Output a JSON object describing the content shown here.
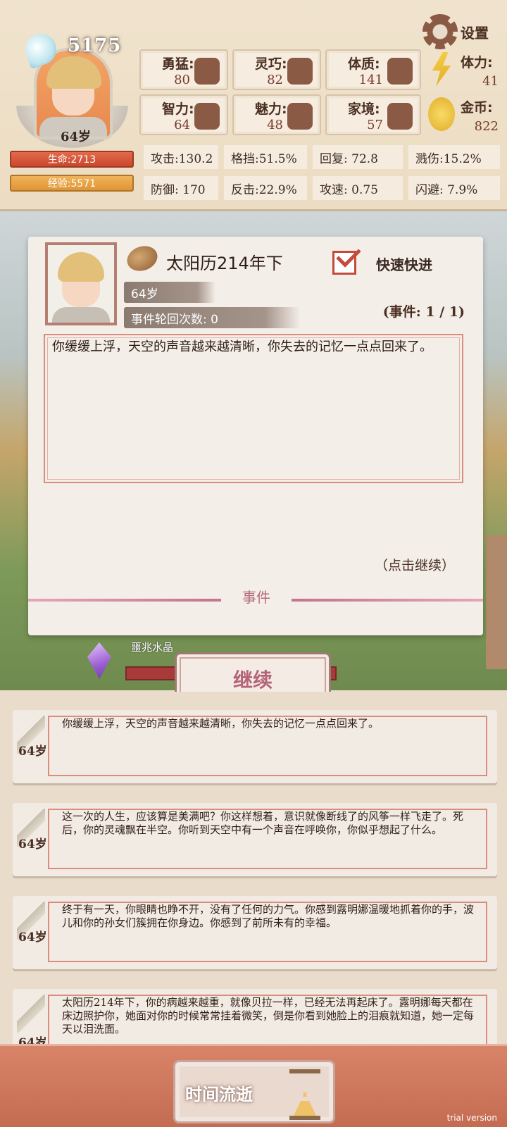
{
  "header": {
    "settings_label": "设置",
    "power_value": "5175",
    "age_badge": "64岁",
    "hp_bar_label": "生命:2713",
    "exp_bar_label": "经验:5571"
  },
  "attributes": [
    {
      "label": "勇猛:",
      "value": "80",
      "icon": "fist-icon"
    },
    {
      "label": "灵巧:",
      "value": "82",
      "icon": "cloak-icon"
    },
    {
      "label": "体质:",
      "value": "141",
      "icon": "muscle-arm-icon"
    },
    {
      "label": "体力:",
      "value": "41",
      "icon": "lightning-icon"
    },
    {
      "label": "智力:",
      "value": "64",
      "icon": "brain-icon"
    },
    {
      "label": "魅力:",
      "value": "48",
      "icon": "flower-icon"
    },
    {
      "label": "家境:",
      "value": "57",
      "icon": "coin-hand-icon"
    },
    {
      "label": "金币:",
      "value": "822",
      "icon": "gold-coin-icon"
    }
  ],
  "combat_stats": [
    {
      "label": "攻击:130.2"
    },
    {
      "label": "格挡:51.5%"
    },
    {
      "label": "回复:  72.8"
    },
    {
      "label": "溅伤:15.2%"
    },
    {
      "label": "防御:  170"
    },
    {
      "label": "反击:22.9%"
    },
    {
      "label": "攻速:  0.75"
    },
    {
      "label": "闪避:  7.9%"
    }
  ],
  "event": {
    "era": "太阳历214年下",
    "age": "64岁",
    "cycle_label": "事件轮回次数: 0",
    "fast_forward_label": "快速快进",
    "event_counter": "(事件: 1 / 1)",
    "text": "你缓缓上浮，天空的声音越来越清晰，你失去的记忆一点点回来了。",
    "click_continue": "（点击继续）",
    "footer_label": "事件"
  },
  "crystal": {
    "label": "噩兆水晶"
  },
  "continue_button": "继续",
  "log": [
    {
      "age": "64岁",
      "text": "你缓缓上浮，天空的声音越来越清晰，你失去的记忆一点点回来了。"
    },
    {
      "age": "64岁",
      "text": "这一次的人生，应该算是美满吧？你这样想着，意识就像断线了的风筝一样飞走了。死后，你的灵魂飘在半空。你听到天空中有一个声音在呼唤你，你似乎想起了什么。"
    },
    {
      "age": "64岁",
      "text": "终于有一天，你眼睛也睁不开，没有了任何的力气。你感到露明娜温暖地抓着你的手，波儿和你的孙女们簇拥在你身边。你感到了前所未有的幸福。"
    },
    {
      "age": "64岁",
      "text": "太阳历214年下，你的病越来越重，就像贝拉一样，已经无法再起床了。露明娜每天都在床边照护你，她面对你的时候常常挂着微笑，倒是你看到她脸上的泪痕就知道，她一定每天以泪洗面。"
    }
  ],
  "bottom": {
    "time_button_label": "时间流逝",
    "trial_label": "trial version"
  },
  "colors": {
    "accent_red": "#c44a3c",
    "hp": "#c9472c",
    "exp": "#de9535",
    "continue_text": "#b56477"
  }
}
